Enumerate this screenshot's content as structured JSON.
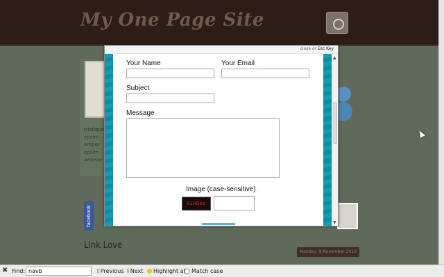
{
  "site": {
    "title": "My One Page Site",
    "left_text": "tristique\nepsim\nempor\nepsim\nAenean",
    "facebook_label": "facebook",
    "link_love": "Link Love",
    "date_badge": "Monday, 8 November 2010"
  },
  "modal": {
    "close_text": "close",
    "or_text": " or ",
    "esc_text": "Esc Key",
    "fields": {
      "name_label": "Your Name",
      "email_label": "Your Email",
      "subject_label": "Subject",
      "message_label": "Message",
      "captcha_label": "Image (case-sensitive)",
      "required_marker": ":"
    },
    "captcha_code": "91HDAc"
  },
  "findbar": {
    "label": "Find:",
    "query": "navb",
    "previous": "Previous",
    "next": "Next",
    "highlight_all": "Highlight all",
    "match_case": "Match case"
  },
  "colors": {
    "header_bg": "#2e1d17",
    "teal_accent": "#1b9ab1",
    "page_bg": "#5f6a5b"
  }
}
